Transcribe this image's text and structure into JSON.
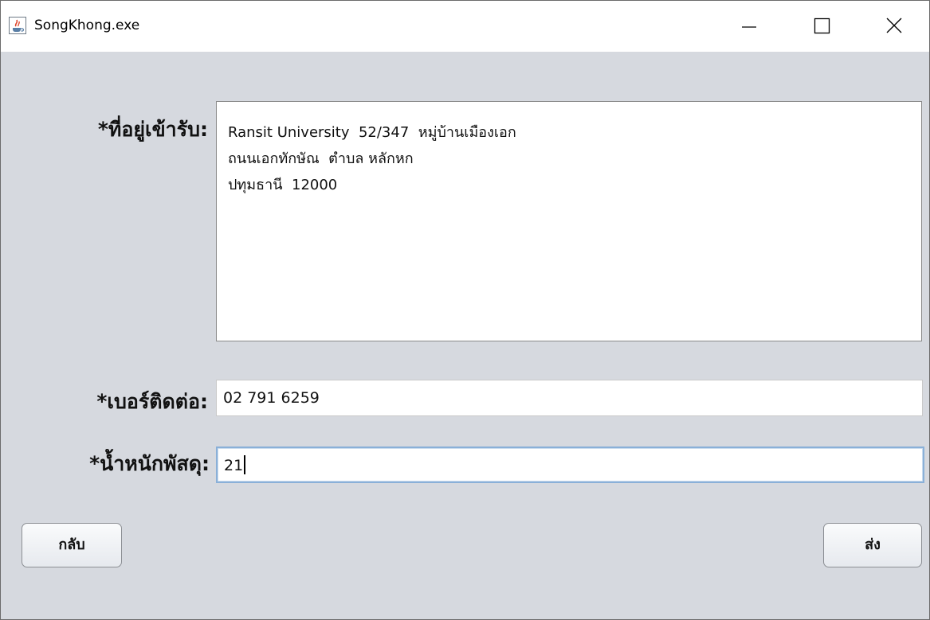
{
  "window": {
    "title": "SongKhong.exe",
    "icon": "java-cup-icon"
  },
  "form": {
    "address_label": "*ที่อยู่เข้ารับ:",
    "address_lines": [
      "Ransit University  52/347  หมู่บ้านเมืองเอก",
      "ถนนเอกทักษัณ  ตำบล หลักหก",
      "ปทุมธานี  12000"
    ],
    "phone_label": "*เบอร์ติดต่อ:",
    "phone_value": "02 791 6259",
    "weight_label": "*น้ำหนักพัสดุ:",
    "weight_value": "21"
  },
  "buttons": {
    "back_label": "กลับ",
    "send_label": "ส่ง"
  }
}
